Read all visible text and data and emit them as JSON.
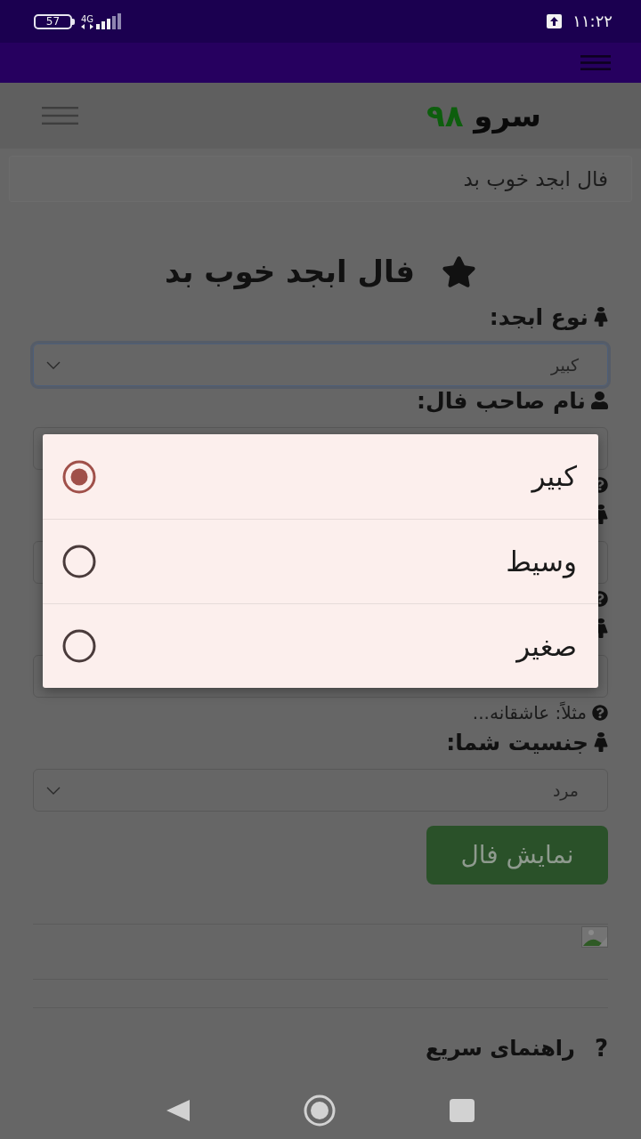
{
  "status_bar": {
    "battery": "57",
    "network": "4G",
    "time": "۱۱:۲۲"
  },
  "header": {
    "logo_text": "سرو",
    "logo_number": "۹۸"
  },
  "breadcrumb": "فال ابجد خوب بد",
  "page_title": "فال ابجد خوب بد",
  "form": {
    "fields": [
      {
        "kind": "select",
        "label": "نوع ابجد:",
        "value": "کبیر",
        "focused": true,
        "help_icon": false
      },
      {
        "kind": "name_input",
        "label": "نام صاحب فال:",
        "focused": false,
        "help_icon": true
      },
      {
        "kind": "input",
        "focused": false,
        "help_icon": true
      },
      {
        "kind": "input",
        "focused": false,
        "help_icon": true,
        "help_text": "مثلاً: عاشقانه..."
      },
      {
        "kind": "select",
        "label": "جنسیت شما:",
        "value": "مرد",
        "focused": false,
        "help_icon": false
      }
    ],
    "submit_button": "نمایش فال"
  },
  "quick_help": {
    "mark": "?",
    "title": "راهنمای سریع"
  },
  "dialog": {
    "options": [
      {
        "label": "کبیر",
        "selected": true
      },
      {
        "label": "وسیط",
        "selected": false
      },
      {
        "label": "صغیر",
        "selected": false
      }
    ]
  }
}
